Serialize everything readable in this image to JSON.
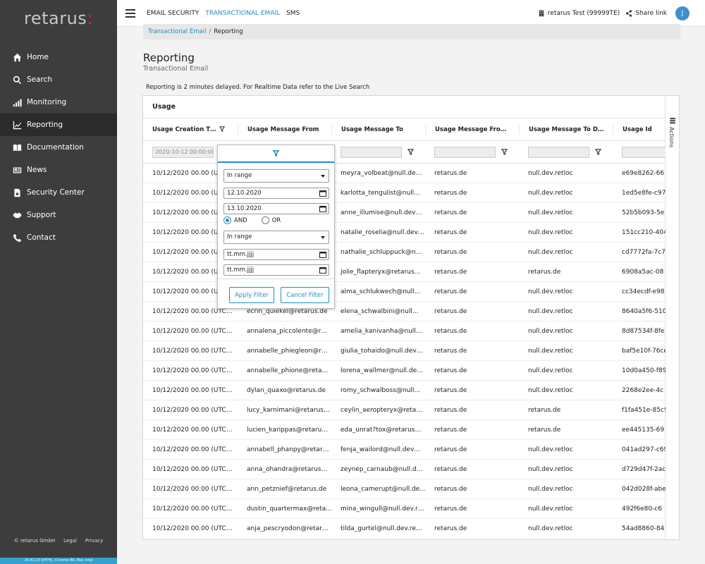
{
  "brand": {
    "logo_text": "retarus",
    "logo_dots": ":"
  },
  "sidebar": {
    "items": [
      {
        "label": "Home",
        "icon": "home-icon"
      },
      {
        "label": "Search",
        "icon": "search-icon"
      },
      {
        "label": "Monitoring",
        "icon": "bar-chart-icon"
      },
      {
        "label": "Reporting",
        "icon": "line-chart-icon"
      },
      {
        "label": "Documentation",
        "icon": "book-icon"
      },
      {
        "label": "News",
        "icon": "newspaper-icon"
      },
      {
        "label": "Security Center",
        "icon": "document-lock-icon"
      },
      {
        "label": "Support",
        "icon": "handshake-icon"
      },
      {
        "label": "Contact",
        "icon": "phone-icon"
      }
    ],
    "active_index": 3,
    "footer": {
      "copyright": "© retarus GmbH",
      "legal": "Legal",
      "privacy": "Privacy"
    },
    "version": "24.41.23 SHTHL, Chrome 86, Mac Intel"
  },
  "topbar": {
    "tabs": [
      "EMAIL SECURITY",
      "TRANSACTIONAL EMAIL",
      "SMS"
    ],
    "active_tab": 1,
    "account": "retarus Test (99999TE)",
    "share": "Share link",
    "avatar_initial": "J"
  },
  "breadcrumb": {
    "parent": "Transactional Email",
    "separator": "/",
    "current": "Reporting"
  },
  "page": {
    "title": "Reporting",
    "subtitle": "Transactional Email",
    "delay_note": "Reporting is 2 minutes delayed. For Realtime Data refer to the Live Search"
  },
  "panel": {
    "title": "Usage",
    "actions_label": "Actions",
    "columns": [
      "Usage Creation T…",
      "Usage Message From",
      "Usage Message To",
      "Usage Message Fro…",
      "Usage Message To D…",
      "Usage Id"
    ],
    "filter_value": "2020-10-12 00:00:00",
    "rows": [
      [
        "10/12/2020 00.00 (UT",
        "",
        "meyra_volbeat@null.de…",
        "retarus.de",
        "null.dev.retloc",
        "e69e8262-66"
      ],
      [
        "10/12/2020 00.00 (UT",
        "",
        "karlotta_tengulist@null…",
        "retarus.de",
        "null.dev.retloc",
        "1ed5e8fe-c97"
      ],
      [
        "10/12/2020 00.00 (UT",
        "",
        "anne_illumise@null.dev…",
        "retarus.de",
        "null.dev.retloc",
        "52b5b093-5e"
      ],
      [
        "10/12/2020 00.00 (UT",
        "",
        "natalie_roselia@null.dev…",
        "retarus.de",
        "null.dev.retloc",
        "151cc210-404"
      ],
      [
        "10/12/2020 00.00 (UT",
        "",
        "nathalie_schluppuck@n…",
        "retarus.de",
        "null.dev.retloc",
        "cd7772fa-7c7"
      ],
      [
        "10/12/2020 00.00 (UT",
        "",
        "jolie_flapteryx@retarus…",
        "retarus.de",
        "retarus.de",
        "6908a5ac-08"
      ],
      [
        "10/12/2020 00.00 (UT",
        "",
        "alma_schlukwech@null…",
        "retarus.de",
        "null.dev.retloc",
        "cc34ecdf-e98"
      ],
      [
        "10/12/2020 00.00 (UTC…",
        "ecrin_quiekel@retarus.de",
        "elena_schwalbini@null…",
        "retarus.de",
        "null.dev.retloc",
        "8640a5f6-510"
      ],
      [
        "10/12/2020 00.00 (UTC…",
        "annalena_piccolente@r…",
        "amelia_kanivanha@null…",
        "retarus.de",
        "null.dev.retloc",
        "8d87534f-8fe"
      ],
      [
        "10/12/2020 00.00 (UTC…",
        "annabelle_phiegleon@r…",
        "giulia_tohaido@null.dev…",
        "retarus.de",
        "null.dev.retloc",
        "baf5e10f-76ce"
      ],
      [
        "10/12/2020 00.00 (UTC…",
        "annabelle_phione@reta…",
        "lorena_wallmer@null.de…",
        "retarus.de",
        "null.dev.retloc",
        "10d0a450-f89"
      ],
      [
        "10/12/2020 00.00 (UTC…",
        "dylan_quaxo@retarus.de",
        "romy_schwalboss@null…",
        "retarus.de",
        "null.dev.retloc",
        "2268e2ee-4c"
      ],
      [
        "10/12/2020 00.00 (UTC…",
        "lucy_karnimani@retarus…",
        "ceylin_aeropteryx@reta…",
        "retarus.de",
        "retarus.de",
        "f1fa451e-85c9"
      ],
      [
        "10/12/2020 00.00 (UTC…",
        "lucien_karippas@retaru…",
        "eda_unrat?tox@retarus…",
        "retarus.de",
        "retarus.de",
        "ee445135-69"
      ],
      [
        "10/12/2020 00.00 (UTC…",
        "annabell_phanpy@retar…",
        "fenja_wailord@null.dev…",
        "retarus.de",
        "null.dev.retloc",
        "041ad297-c69"
      ],
      [
        "10/12/2020 00.00 (UTC…",
        "anna_ohandra@retarus…",
        "zeynep_carnaub@null.d…",
        "retarus.de",
        "null.dev.retloc",
        "d729d47f-2ac"
      ],
      [
        "10/12/2020 00.00 (UTC…",
        "ann_petznief@retarus.de",
        "leona_camerupt@null.de…",
        "retarus.de",
        "null.dev.retloc",
        "042d028f-abe"
      ],
      [
        "10/12/2020 00.00 (UTC…",
        "dustin_quartermax@reta…",
        "mina_wingull@null.dev.r…",
        "retarus.de",
        "null.dev.retloc",
        "492f6e80-c6"
      ],
      [
        "10/12/2020 00.00 (UTC…",
        "anja_pescryodon@retar…",
        "tilda_gurtel@null.dev.re…",
        "retarus.de",
        "null.dev.retloc",
        "54ad8860-84"
      ]
    ]
  },
  "filter_popup": {
    "condition1": "In range",
    "date_from": "12.10.2020",
    "date_to": "13.10.2020",
    "and_label": "AND",
    "or_label": "OR",
    "condition2": "In range",
    "date_placeholder": "tt.mm.jjjj",
    "apply_label": "Apply Filter",
    "cancel_label": "Cancel Filter"
  },
  "colors": {
    "sidebar": "#3d3d3d",
    "accent": "#1f8fc4",
    "logo_dot": "#e0242b"
  }
}
